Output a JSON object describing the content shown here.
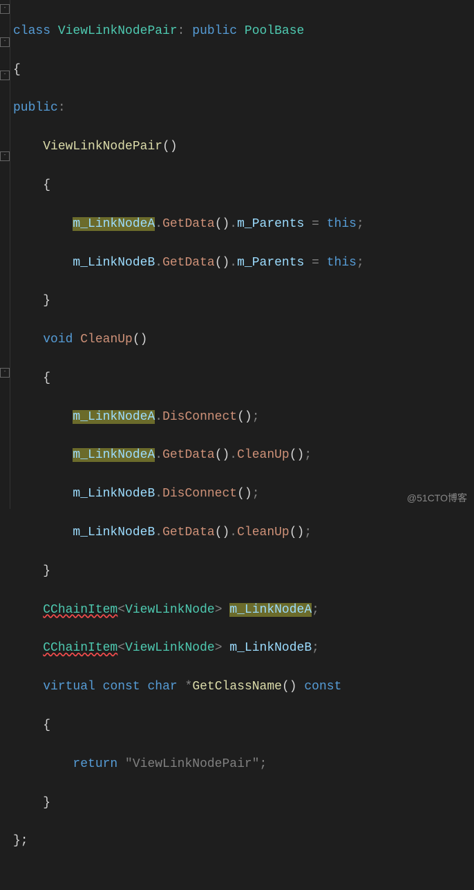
{
  "code": {
    "class_kw": "class",
    "class_name": "ViewLinkNodePair",
    "colon": ":",
    "public_kw": "public",
    "base_class": "PoolBase",
    "open_brace": "{",
    "public_label": "public",
    "public_colon": ":",
    "ctor_name": "ViewLinkNodePair",
    "parens_empty": "()",
    "m_LinkNodeA": "m_LinkNodeA",
    "m_LinkNodeB": "m_LinkNodeB",
    "dot": ".",
    "GetData": "GetData",
    "m_Parents": "m_Parents",
    "equals": " = ",
    "this": "this",
    "semi": ";",
    "close_brace": "}",
    "void_kw": "void",
    "CleanUp": "CleanUp",
    "DisConnect": "DisConnect",
    "CChainItem": "CChainItem",
    "lt": "<",
    "gt": ">",
    "ViewLinkNode": "ViewLinkNode",
    "virtual_kw": "virtual",
    "const_kw": "const",
    "char_kw": "char",
    "star": "*",
    "GetClassName": "GetClassName",
    "return_kw": "return",
    "str_lit": "\"ViewLinkNodePair\"",
    "final_brace": "};"
  },
  "watermark": "@51CTO博客"
}
